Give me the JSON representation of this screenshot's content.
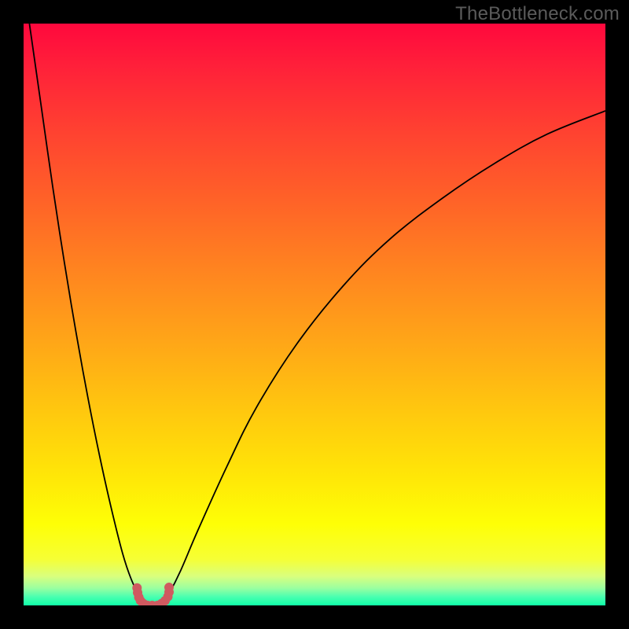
{
  "attribution": "TheBottleneck.com",
  "colors": {
    "frame_bg": "#000000",
    "gradient_top": "#ff083d",
    "gradient_bottom": "#10ffa8",
    "curve_stroke": "#000000",
    "marker_fill": "#cf5a60"
  },
  "chart_data": {
    "type": "line",
    "title": "",
    "xlabel": "",
    "ylabel": "",
    "xlim": [
      0,
      100
    ],
    "ylim": [
      0,
      100
    ],
    "series": [
      {
        "name": "bottleneck-curve-left",
        "x": [
          1,
          3,
          5,
          7,
          9,
          11,
          13,
          15,
          17,
          18.5,
          20,
          21,
          22
        ],
        "y": [
          100,
          86,
          72,
          59,
          47,
          36,
          26,
          17,
          9,
          4.5,
          1.5,
          0.5,
          0
        ]
      },
      {
        "name": "bottleneck-curve-right",
        "x": [
          23,
          24,
          25,
          27,
          30,
          35,
          40,
          47,
          55,
          63,
          72,
          81,
          90,
          100
        ],
        "y": [
          0,
          0.5,
          2,
          6,
          13,
          24,
          34,
          45,
          55,
          63,
          70,
          76,
          81,
          85
        ]
      }
    ],
    "markers": {
      "name": "data-points",
      "x": [
        19.5,
        19.6,
        19.8,
        20.1,
        20.6,
        21.3,
        22.1,
        23.0,
        23.7,
        24.3,
        24.8,
        25.0,
        25.0
      ],
      "y": [
        3.0,
        2.2,
        1.4,
        0.8,
        0.3,
        0.0,
        0.0,
        0.0,
        0.3,
        0.8,
        1.5,
        2.3,
        3.1
      ],
      "radius": 6
    }
  }
}
